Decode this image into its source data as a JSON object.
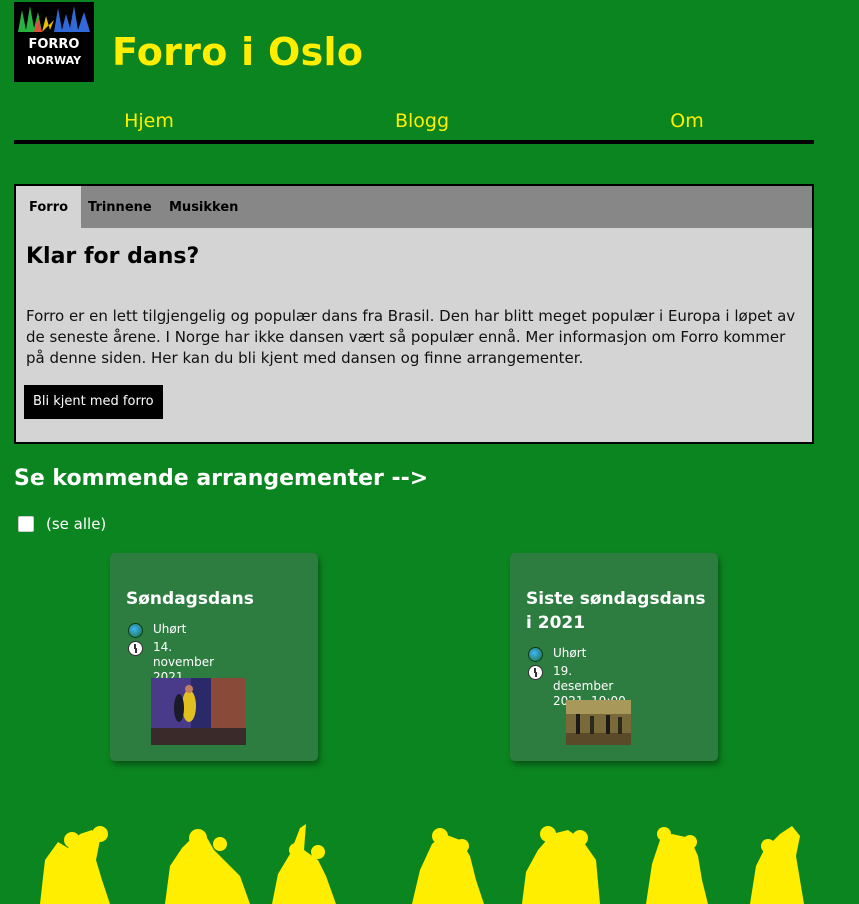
{
  "site": {
    "title": "Forro i Oslo",
    "logo_text_line1": "FORRO",
    "logo_text_line2": "NORWAY"
  },
  "nav": {
    "items": [
      {
        "label": "Hjem"
      },
      {
        "label": "Blogg"
      },
      {
        "label": "Om"
      }
    ]
  },
  "intro": {
    "tabs": [
      {
        "label": "Forro",
        "active": true
      },
      {
        "label": "Trinnene",
        "active": false
      },
      {
        "label": "Musikken",
        "active": false
      }
    ],
    "heading": "Klar for dans?",
    "body": "Forro er en lett tilgjengelig og populær dans fra Brasil. Den har blitt meget populær i Europa i løpet av de seneste årene. I Norge har ikke dansen vært så populær ennå. Mer informasjon om Forro kommer på denne siden. Her kan du bli kjent med dansen og finne arrangementer.",
    "button_label": "Bli kjent med forro"
  },
  "events": {
    "heading": "Se kommende arrangementer -->",
    "see_all_label": "(se alle)",
    "see_all_checked": false,
    "cards": [
      {
        "title": "Søndagsdans",
        "location": "Uhørt",
        "date": "14. november 2021, 19:00",
        "location_icon": "globe-icon",
        "date_icon": "clock-icon"
      },
      {
        "title": "Siste søndagsdans i 2021",
        "location": "Uhørt",
        "date": "19. desember 2021, 19:00",
        "location_icon": "globe-icon",
        "date_icon": "clock-icon"
      }
    ]
  },
  "colors": {
    "background": "#0b8520",
    "accent": "#ffee00",
    "card": "#2e7d40",
    "panel": "#d4d4d4",
    "tabbar": "#878787"
  }
}
